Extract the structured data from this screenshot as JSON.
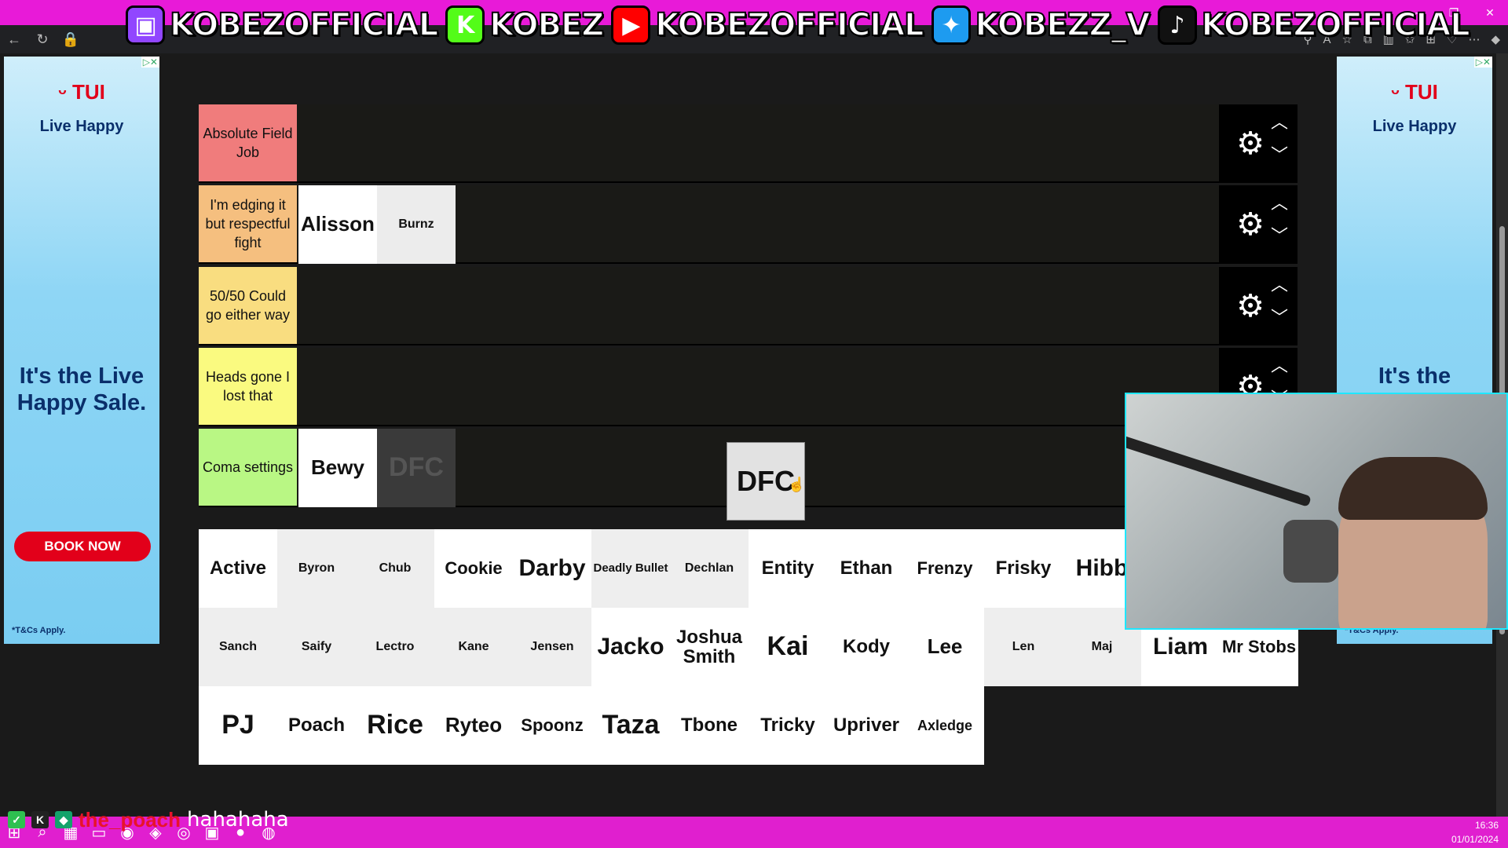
{
  "overlay": {
    "socials": [
      {
        "icon": "twitch-icon",
        "glyph": "▣",
        "color": "#9146ff",
        "handle": "KOBEZOFFICIAL"
      },
      {
        "icon": "kick-icon",
        "glyph": "K",
        "color": "#53fc18",
        "handle": "KOBEZ"
      },
      {
        "icon": "youtube-icon",
        "glyph": "▶",
        "color": "#ff0000",
        "handle": "KOBEZOFFICIAL"
      },
      {
        "icon": "twitter-icon",
        "glyph": "✦",
        "color": "#1d9bf0",
        "handle": "KOBEZZ_V"
      },
      {
        "icon": "tiktok-icon",
        "glyph": "♪",
        "color": "#111111",
        "handle": "KOBEZOFFICIAL"
      }
    ]
  },
  "ads": {
    "brand": "TUI",
    "tagline": "Live Happy",
    "headline": "It's the Live Happy Sale.",
    "headline_partial": "It's the",
    "button": "BOOK NOW",
    "terms": "*T&Cs Apply."
  },
  "tiers": [
    {
      "label": "Absolute Field Job",
      "color": "#f07c7c",
      "items": []
    },
    {
      "label": "I'm edging it but respectful fight",
      "color": "#f5bf7f",
      "items": [
        {
          "name": "Alisson",
          "bg": "#ffffff",
          "size": 26
        },
        {
          "name": "Burnz",
          "bg": "#ececec",
          "size": 16
        }
      ]
    },
    {
      "label": "50/50 Could go either way",
      "color": "#f9dd80",
      "items": []
    },
    {
      "label": "Heads gone I lost that",
      "color": "#fafa80",
      "items": []
    },
    {
      "label": "Coma settings",
      "color": "#b9f784",
      "items": [
        {
          "name": "Bewy",
          "bg": "#ffffff",
          "size": 26
        },
        {
          "name": "DFC",
          "bg": "#3a3a3a",
          "size": 34,
          "ghost": true
        }
      ]
    }
  ],
  "dragging": {
    "name": "DFC"
  },
  "pool": [
    {
      "name": "Active",
      "bg": "#ffffff",
      "size": 24
    },
    {
      "name": "Byron",
      "bg": "#eeeeee",
      "size": 16
    },
    {
      "name": "Chub",
      "bg": "#eeeeee",
      "size": 16
    },
    {
      "name": "Cookie",
      "bg": "#ffffff",
      "size": 22
    },
    {
      "name": "Darby",
      "bg": "#ffffff",
      "size": 30
    },
    {
      "name": "Deadly Bullet",
      "bg": "#eeeeee",
      "size": 15
    },
    {
      "name": "Dechlan",
      "bg": "#eeeeee",
      "size": 16
    },
    {
      "name": "Entity",
      "bg": "#ffffff",
      "size": 24
    },
    {
      "name": "Ethan",
      "bg": "#ffffff",
      "size": 24
    },
    {
      "name": "Frenzy",
      "bg": "#ffffff",
      "size": 22
    },
    {
      "name": "Frisky",
      "bg": "#ffffff",
      "size": 24
    },
    {
      "name": "Hibb",
      "bg": "#ffffff",
      "size": 30
    },
    {
      "name": "",
      "bg": "#ffffff",
      "size": 16
    },
    {
      "name": "",
      "bg": "#ffffff",
      "size": 16
    },
    {
      "name": "Sanch",
      "bg": "#eeeeee",
      "size": 16
    },
    {
      "name": "Saify",
      "bg": "#eeeeee",
      "size": 16
    },
    {
      "name": "Lectro",
      "bg": "#eeeeee",
      "size": 16
    },
    {
      "name": "Kane",
      "bg": "#eeeeee",
      "size": 16
    },
    {
      "name": "Jensen",
      "bg": "#eeeeee",
      "size": 16
    },
    {
      "name": "Jacko",
      "bg": "#ffffff",
      "size": 30
    },
    {
      "name": "Joshua Smith",
      "bg": "#ffffff",
      "size": 24
    },
    {
      "name": "Kai",
      "bg": "#ffffff",
      "size": 34
    },
    {
      "name": "Kody",
      "bg": "#ffffff",
      "size": 24
    },
    {
      "name": "Lee",
      "bg": "#ffffff",
      "size": 26
    },
    {
      "name": "Len",
      "bg": "#eeeeee",
      "size": 16
    },
    {
      "name": "Maj",
      "bg": "#eeeeee",
      "size": 16
    },
    {
      "name": "Liam",
      "bg": "#ffffff",
      "size": 30
    },
    {
      "name": "Mr Stobs",
      "bg": "#ffffff",
      "size": 22
    },
    {
      "name": "PJ",
      "bg": "#ffffff",
      "size": 34
    },
    {
      "name": "Poach",
      "bg": "#ffffff",
      "size": 24
    },
    {
      "name": "Rice",
      "bg": "#ffffff",
      "size": 34
    },
    {
      "name": "Ryteo",
      "bg": "#ffffff",
      "size": 26
    },
    {
      "name": "Spoonz",
      "bg": "#ffffff",
      "size": 22
    },
    {
      "name": "Taza",
      "bg": "#ffffff",
      "size": 34
    },
    {
      "name": "Tbone",
      "bg": "#ffffff",
      "size": 24
    },
    {
      "name": "Tricky",
      "bg": "#ffffff",
      "size": 24
    },
    {
      "name": "Upriver",
      "bg": "#ffffff",
      "size": 24
    },
    {
      "name": "Axledge",
      "bg": "#ffffff",
      "size": 18
    }
  ],
  "chat": {
    "user": "the_poach",
    "message": "hahahaha"
  },
  "taskbar": {
    "time": "16:36",
    "date": "01/01/2024"
  }
}
